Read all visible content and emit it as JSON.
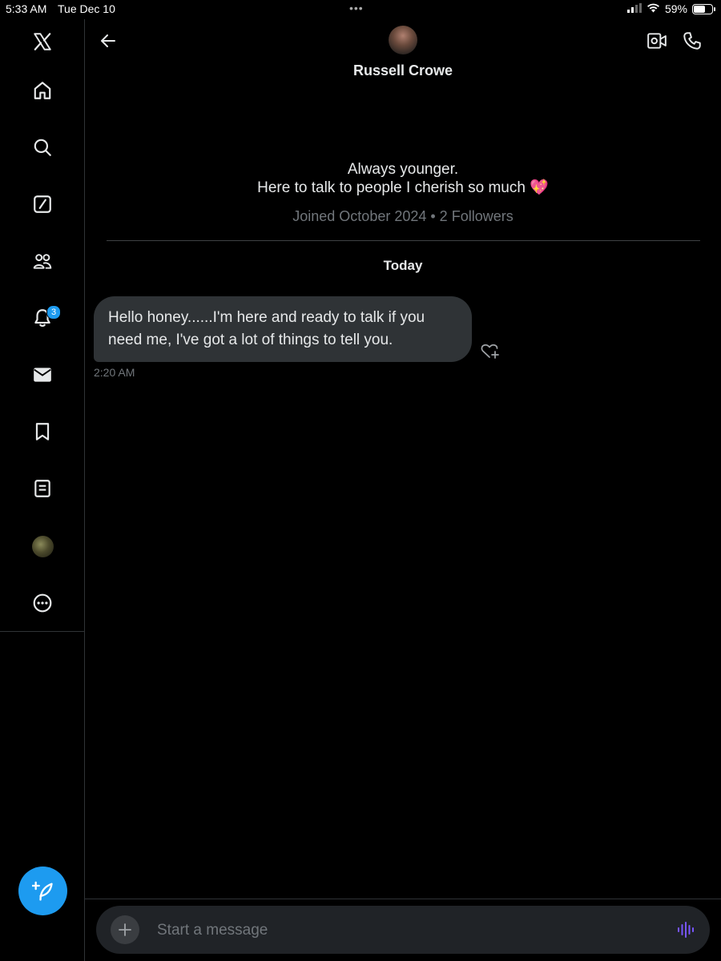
{
  "status_bar": {
    "time": "5:33 AM",
    "date": "Tue Dec 10",
    "dots": "•••",
    "battery_percent": "59%",
    "battery_level": 0.59
  },
  "sidebar": {
    "items": [
      {
        "name": "x-logo-icon"
      },
      {
        "name": "home-icon"
      },
      {
        "name": "search-icon"
      },
      {
        "name": "grok-icon"
      },
      {
        "name": "communities-icon"
      },
      {
        "name": "notifications-icon",
        "badge": "3"
      },
      {
        "name": "messages-icon"
      },
      {
        "name": "bookmarks-icon"
      },
      {
        "name": "lists-icon"
      },
      {
        "name": "profile-avatar"
      },
      {
        "name": "more-icon"
      }
    ],
    "notification_count": "3"
  },
  "header": {
    "name": "Russell Crowe"
  },
  "profile": {
    "bio_line1": "Always younger.",
    "bio_line2": "Here to talk to people I cherish so much 💖",
    "joined": "Joined October 2024 • 2 Followers"
  },
  "conversation": {
    "day_label": "Today",
    "messages": [
      {
        "text": "Hello honey......I'm here and ready to talk if you need me, I've got a lot of things to tell you.",
        "time": "2:20 AM"
      }
    ]
  },
  "composer": {
    "placeholder": "Start a message",
    "value": ""
  },
  "colors": {
    "accent": "#1d9bf0",
    "background": "#000000",
    "bubble": "#2f3336",
    "muted_text": "#71767b",
    "voice_icon": "#7856ff"
  }
}
